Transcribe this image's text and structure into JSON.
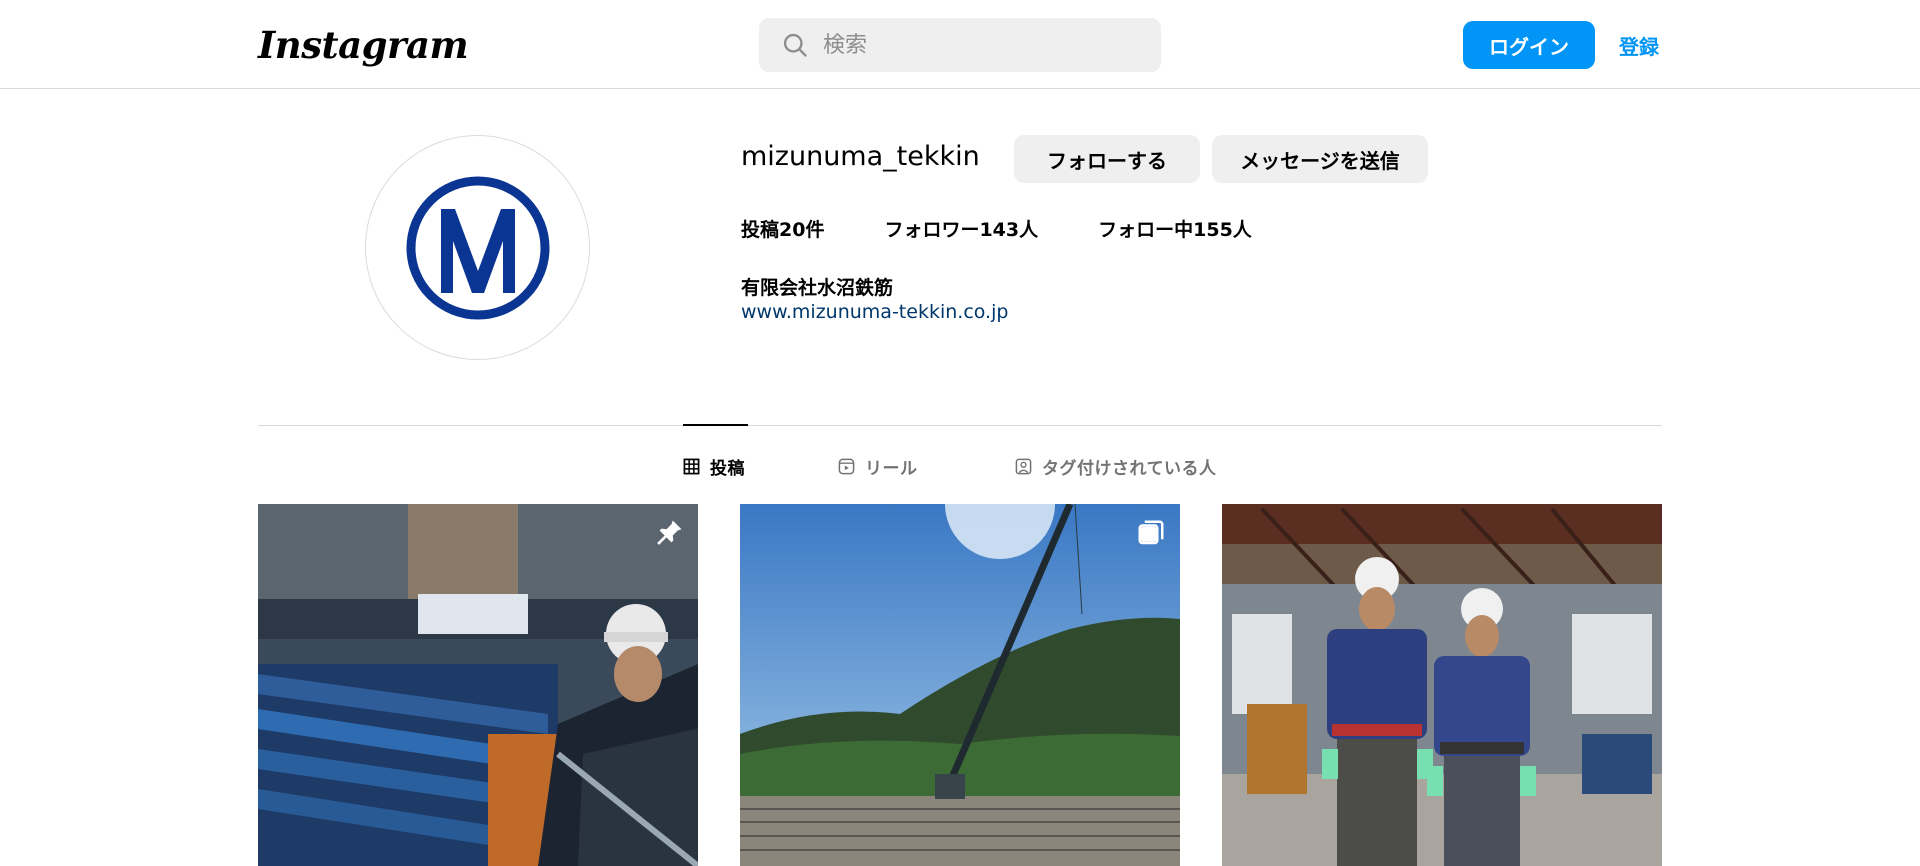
{
  "header": {
    "logo_text": "Instagram",
    "search_placeholder": "検索",
    "login_label": "ログイン",
    "signup_label": "登録"
  },
  "profile": {
    "username": "mizunuma_tekkin",
    "follow_label": "フォローする",
    "message_label": "メッセージを送信",
    "stats": {
      "posts": "投稿20件",
      "followers": "フォロワー143人",
      "following": "フォロー中155人"
    },
    "full_name": "有限会社水沼鉄筋",
    "website": "www.mizunuma-tekkin.co.jp"
  },
  "tabs": [
    {
      "label": "投稿",
      "icon": "grid-icon",
      "active": true
    },
    {
      "label": "リール",
      "icon": "reels-icon",
      "active": false
    },
    {
      "label": "タグ付けされている人",
      "icon": "tagged-icon",
      "active": false
    }
  ],
  "posts": [
    {
      "description": "worker-with-rebar",
      "badge": "pin-icon"
    },
    {
      "description": "crane-construction-site",
      "badge": "carousel-icon"
    },
    {
      "description": "two-workers-in-factory",
      "badge": ""
    }
  ],
  "colors": {
    "accent": "#0095f6",
    "brand_logo": "#0a3592",
    "link": "#00376b",
    "secondary_text": "#737373",
    "border": "#dbdbdb"
  }
}
